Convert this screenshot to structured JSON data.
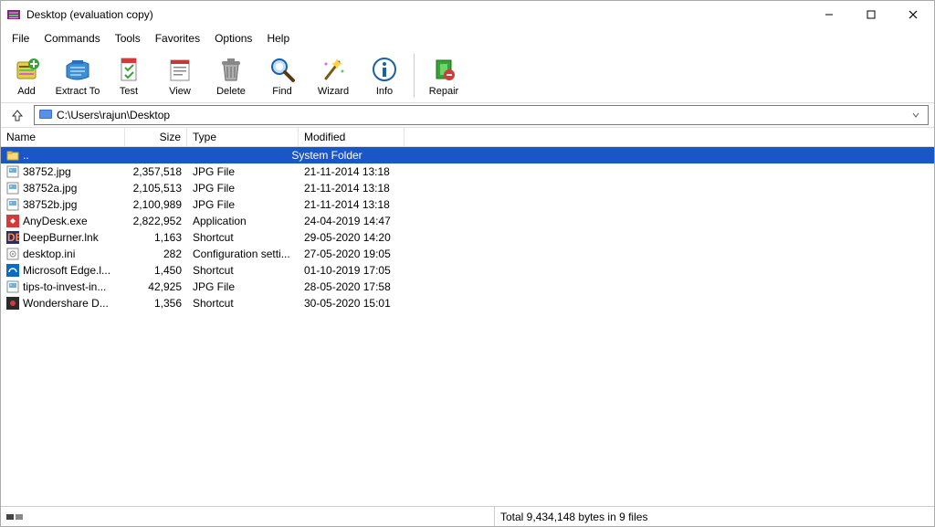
{
  "title": "Desktop (evaluation copy)",
  "menu": [
    "File",
    "Commands",
    "Tools",
    "Favorites",
    "Options",
    "Help"
  ],
  "toolbar": [
    {
      "label": "Add",
      "icon": "add"
    },
    {
      "label": "Extract To",
      "icon": "extract"
    },
    {
      "label": "Test",
      "icon": "test"
    },
    {
      "label": "View",
      "icon": "view"
    },
    {
      "label": "Delete",
      "icon": "delete"
    },
    {
      "label": "Find",
      "icon": "find"
    },
    {
      "label": "Wizard",
      "icon": "wizard"
    },
    {
      "label": "Info",
      "icon": "info"
    }
  ],
  "toolbar_after_sep": [
    {
      "label": "Repair",
      "icon": "repair"
    }
  ],
  "path": "C:\\Users\\rajun\\Desktop",
  "columns": {
    "name": "Name",
    "size": "Size",
    "type": "Type",
    "modified": "Modified"
  },
  "parent_row": {
    "name": "..",
    "type": "System Folder"
  },
  "files": [
    {
      "name": "38752.jpg",
      "size": "2,357,518",
      "type": "JPG File",
      "modified": "21-11-2014 13:18",
      "icon": "jpg"
    },
    {
      "name": "38752a.jpg",
      "size": "2,105,513",
      "type": "JPG File",
      "modified": "21-11-2014 13:18",
      "icon": "jpg"
    },
    {
      "name": "38752b.jpg",
      "size": "2,100,989",
      "type": "JPG File",
      "modified": "21-11-2014 13:18",
      "icon": "jpg"
    },
    {
      "name": "AnyDesk.exe",
      "size": "2,822,952",
      "type": "Application",
      "modified": "24-04-2019 14:47",
      "icon": "anydesk"
    },
    {
      "name": "DeepBurner.lnk",
      "size": "1,163",
      "type": "Shortcut",
      "modified": "29-05-2020 14:20",
      "icon": "deepburner"
    },
    {
      "name": "desktop.ini",
      "size": "282",
      "type": "Configuration setti...",
      "modified": "27-05-2020 19:05",
      "icon": "ini"
    },
    {
      "name": "Microsoft Edge.l...",
      "size": "1,450",
      "type": "Shortcut",
      "modified": "01-10-2019 17:05",
      "icon": "edge"
    },
    {
      "name": "tips-to-invest-in...",
      "size": "42,925",
      "type": "JPG File",
      "modified": "28-05-2020 17:58",
      "icon": "jpg"
    },
    {
      "name": "Wondershare D...",
      "size": "1,356",
      "type": "Shortcut",
      "modified": "30-05-2020 15:01",
      "icon": "wondershare"
    }
  ],
  "status": "Total 9,434,148 bytes in 9 files"
}
